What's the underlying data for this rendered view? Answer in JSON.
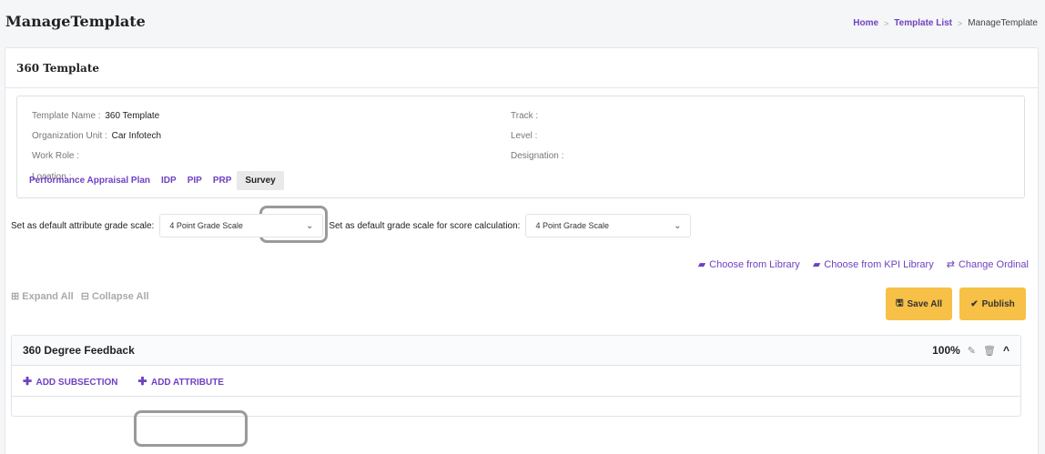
{
  "header": {
    "title": "ManageTemplate",
    "breadcrumb": {
      "home": "Home",
      "list": "Template List",
      "current": "ManageTemplate",
      "sep": ">"
    }
  },
  "card": {
    "title": "360 Template"
  },
  "info": {
    "template_name_label": "Template Name :",
    "template_name_value": "360 Template",
    "org_unit_label": "Organization Unit :",
    "org_unit_value": "Car Infotech",
    "work_role_label": "Work Role :",
    "location_label": "Location :",
    "track_label": "Track :",
    "level_label": "Level :",
    "designation_label": "Designation :"
  },
  "tabs": [
    "Performance Appraisal Plan",
    "IDP",
    "PIP",
    "PRP",
    "Survey"
  ],
  "active_tab": "Survey",
  "grade": {
    "attribute_label": "Set as default attribute grade scale:",
    "attribute_value": "4 Point Grade Scale",
    "score_label": "Set as default grade scale for score calculation:",
    "score_value": "4 Point Grade Scale"
  },
  "library": {
    "choose_library": "Choose from Library",
    "choose_kpi": "Choose from KPI Library",
    "change_ordinal": "Change Ordinal"
  },
  "expand": {
    "expand_all": "Expand All",
    "collapse_all": "Collapse All"
  },
  "buttons": {
    "save_all": "Save All",
    "publish": "Publish"
  },
  "section": {
    "title": "360 Degree Feedback",
    "percent": "100%",
    "add_subsection": "ADD SUBSECTION",
    "add_attribute": "ADD ATTRIBUTE"
  },
  "colors": {
    "accent": "#6f42c1",
    "button": "#f7c046"
  }
}
